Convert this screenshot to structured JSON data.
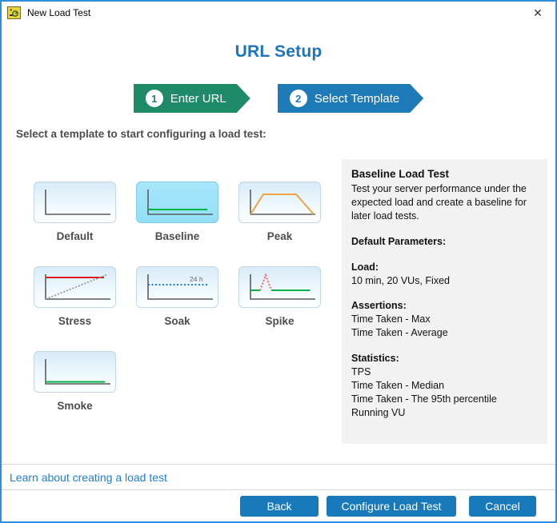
{
  "window": {
    "title": "New Load Test",
    "close_icon": "✕"
  },
  "header": {
    "title": "URL Setup"
  },
  "steps": [
    {
      "number": "1",
      "label": "Enter URL",
      "color": "#1f8a67"
    },
    {
      "number": "2",
      "label": "Select Template",
      "color": "#1f7bb8"
    }
  ],
  "instruction": "Select a template to start configuring a load test:",
  "templates": [
    {
      "label": "Default",
      "selected": false
    },
    {
      "label": "Baseline",
      "selected": true
    },
    {
      "label": "Peak",
      "selected": false
    },
    {
      "label": "Stress",
      "selected": false
    },
    {
      "label": "Soak",
      "selected": false,
      "annotation": "24 h"
    },
    {
      "label": "Spike",
      "selected": false
    },
    {
      "label": "Smoke",
      "selected": false
    }
  ],
  "details": {
    "title": "Baseline Load Test",
    "description": "Test your server performance under the expected load and create a baseline for later load tests.",
    "sections": [
      {
        "heading": "Default Parameters:",
        "lines": []
      },
      {
        "heading": "Load:",
        "lines": [
          "10 min, 20 VUs, Fixed"
        ]
      },
      {
        "heading": "Assertions:",
        "lines": [
          "Time Taken - Max",
          "Time Taken - Average"
        ]
      },
      {
        "heading": "Statistics:",
        "lines": [
          "TPS",
          "Time Taken - Median",
          "Time Taken - The 95th percentile",
          "Running VU"
        ]
      }
    ]
  },
  "footer": {
    "help_link": "Learn about creating a load test",
    "buttons": [
      {
        "label": "Back"
      },
      {
        "label": "Configure Load Test"
      },
      {
        "label": "Cancel"
      }
    ]
  },
  "colors": {
    "window_border": "#2e8fdf",
    "heading_blue": "#1c75bc",
    "step_green": "#1f8a67",
    "step_blue": "#1f7bb8",
    "selected_cyan": "#9fe2fa",
    "link_blue": "#1f7ed6",
    "button_blue": "#1879bb",
    "chart_green": "#00b44a",
    "chart_orange": "#f2a243",
    "chart_red": "#e01818"
  }
}
